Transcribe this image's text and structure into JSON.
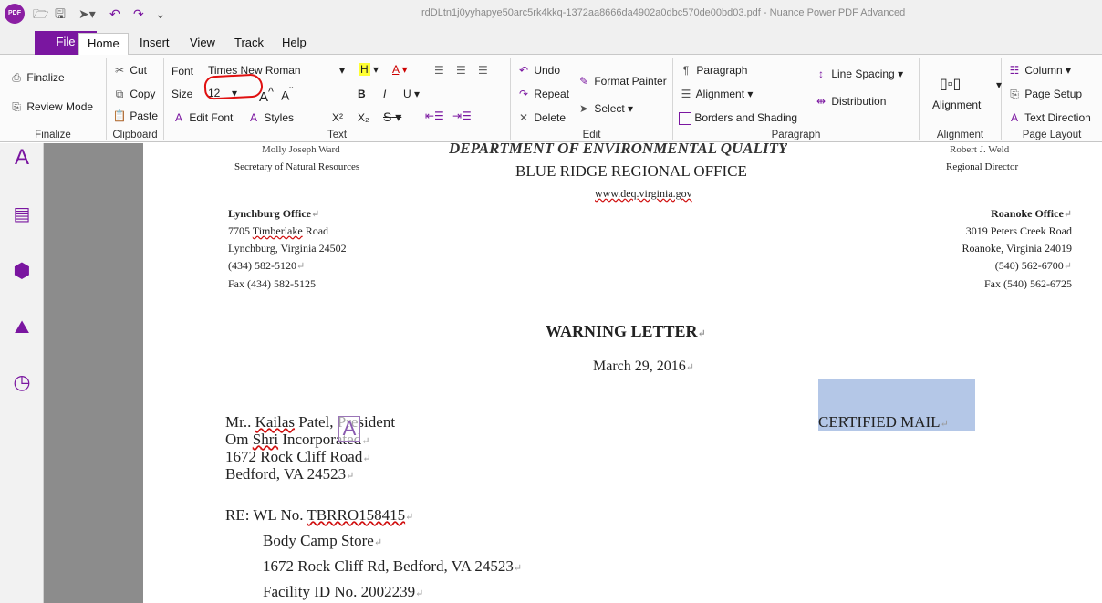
{
  "titlebar": {
    "title": "rdDLtn1j0yyhapye50arc5rk4kkq-1372aa8666da4902a0dbc570de00bd03.pdf - Nuance Power PDF Advanced",
    "logo_text": "PDF"
  },
  "menu": {
    "tabs": [
      "File",
      "Home",
      "Insert",
      "View",
      "Track",
      "Help"
    ]
  },
  "ribbon": {
    "finalize": {
      "finalize_label": "Finalize",
      "review_mode_label": "Review Mode",
      "group_label": "Finalize"
    },
    "clipboard": {
      "cut_label": "Cut",
      "copy_label": "Copy",
      "paste_label": "Paste",
      "group_label": "Clipboard"
    },
    "text": {
      "font_label": "Font",
      "font_value": "Times New Roman",
      "size_label": "Size",
      "size_value": "12",
      "edit_font_label": "Edit Font",
      "styles_label": "Styles",
      "highlight_label": "H",
      "font_color_label": "A",
      "bold_label": "B",
      "italic_label": "I",
      "underline_label": "U",
      "strike_label": "S",
      "grow_label": "A",
      "shrink_label": "A",
      "superscript_label": "X²",
      "subscript_label": "X₂",
      "group_label": "Text"
    },
    "edit": {
      "undo_label": "Undo",
      "repeat_label": "Repeat",
      "delete_label": "Delete",
      "format_painter_label": "Format Painter",
      "select_label": "Select",
      "group_label": "Edit"
    },
    "paragraph": {
      "paragraph_label": "Paragraph",
      "alignment_label": "Alignment",
      "borders_label": "Borders and Shading",
      "line_spacing_label": "Line Spacing",
      "distribution_label": "Distribution",
      "group_label": "Paragraph"
    },
    "alignment": {
      "alignment_label": "Alignment",
      "group_label": "Alignment"
    },
    "page_layout": {
      "column_label": "Column",
      "page_setup_label": "Page Setup",
      "text_direction_label": "Text Direction",
      "group_label": "Page Layout"
    }
  },
  "document": {
    "header_left_name": "Molly Joseph Ward",
    "header_left_title": "Secretary of Natural Resources",
    "dept_title": "DEPARTMENT OF ENVIRONMENTAL QUALITY",
    "office_title": "BLUE RIDGE REGIONAL OFFICE",
    "website": "www.deq.virginia.gov",
    "header_right_name": "Robert J. Weld",
    "header_right_title": "Regional Director",
    "lynchburg": {
      "heading": "Lynchburg Office",
      "addr_num": "7705",
      "addr_street_word": "Timberlake",
      "addr_road": "Road",
      "city": "Lynchburg, Virginia 24502",
      "phone": "(434) 582-5120",
      "fax": "Fax (434) 582-5125"
    },
    "roanoke": {
      "heading": "Roanoke Office",
      "address": "3019 Peters Creek Road",
      "city": "Roanoke, Virginia 24019",
      "phone": "(540) 562-6700",
      "fax": "Fax (540) 562-6725"
    },
    "letter_title": "WARNING LETTER",
    "date": "March 29, 2016",
    "certified": "CERTIFIED MAIL",
    "recipient": {
      "line1_prefix": "Mr.. ",
      "line1_name": "Kailas",
      "line1_rest": " Patel, President",
      "line2_prefix": "Om ",
      "line2_word": "Shri",
      "line2_rest": " Incorporated",
      "line3": "1672 Rock Cliff Road",
      "line4": "Bedford, VA 24523"
    },
    "re": {
      "label": "RE:  WL No. ",
      "number": "TBRRO158415",
      "line2": "Body Camp Store",
      "line3": "1672 Rock Cliff Rd, Bedford, VA 24523",
      "line4": "Facility ID No. 2002239"
    },
    "para_mark": "↵"
  }
}
